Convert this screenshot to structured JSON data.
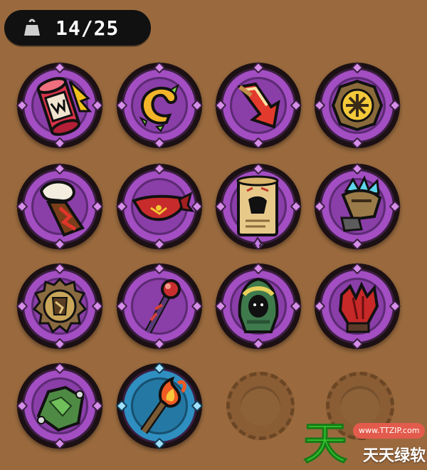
{
  "inventory": {
    "weight_icon": "weight-icon",
    "capacity_text": "14/25"
  },
  "slots": [
    {
      "item": "red-scroll-bundle-icon",
      "frame": "purple"
    },
    {
      "item": "golden-horn-icon",
      "frame": "purple"
    },
    {
      "item": "red-arrow-shard-icon",
      "frame": "purple"
    },
    {
      "item": "bronze-shield-sun-icon",
      "frame": "purple"
    },
    {
      "item": "fur-gauntlet-icon",
      "frame": "purple"
    },
    {
      "item": "red-bandana-icon",
      "frame": "purple"
    },
    {
      "item": "treasure-map-scroll-icon",
      "frame": "purple"
    },
    {
      "item": "spiked-gauntlet-icon",
      "frame": "purple"
    },
    {
      "item": "gear-seal-icon",
      "frame": "purple"
    },
    {
      "item": "red-orb-staff-icon",
      "frame": "purple"
    },
    {
      "item": "hooded-cloak-icon",
      "frame": "purple"
    },
    {
      "item": "red-claw-glove-icon",
      "frame": "purple"
    },
    {
      "item": "green-crystal-tablet-icon",
      "frame": "purple"
    },
    {
      "item": "flame-torch-icon",
      "frame": "blue"
    },
    {
      "item": "empty-slot",
      "frame": "empty"
    },
    {
      "item": "empty-slot",
      "frame": "empty"
    }
  ],
  "watermark": {
    "logo_char": "天",
    "url": "www.TTZIP.com",
    "name": "天天绿软"
  },
  "colors": {
    "background": "#9a6a3e",
    "frame_purple": "#a34ec2",
    "frame_blue": "#2f8fc0",
    "watermark_green": "#2fc42c",
    "watermark_red": "#e35b4c"
  }
}
